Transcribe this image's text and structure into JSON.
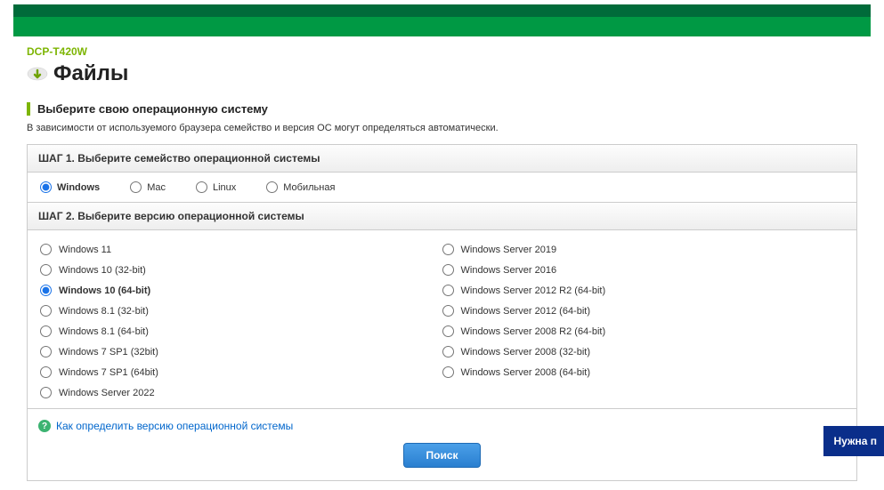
{
  "product_model": "DCP-T420W",
  "page_title": "Файлы",
  "section_heading": "Выберите свою операционную систему",
  "auto_detect_hint": "В зависимости от используемого браузера семейство и версия ОС могут определяться автоматически.",
  "step1_label": "ШАГ 1. Выберите семейство операционной системы",
  "step2_label": "ШАГ 2. Выберите версию операционной системы",
  "os_families": [
    {
      "label": "Windows",
      "selected": true
    },
    {
      "label": "Mac",
      "selected": false
    },
    {
      "label": "Linux",
      "selected": false
    },
    {
      "label": "Мобильная",
      "selected": false
    }
  ],
  "os_versions_col1": [
    {
      "label": "Windows 11",
      "selected": false
    },
    {
      "label": "Windows 10 (32-bit)",
      "selected": false
    },
    {
      "label": "Windows 10 (64-bit)",
      "selected": true
    },
    {
      "label": "Windows 8.1 (32-bit)",
      "selected": false
    },
    {
      "label": "Windows 8.1 (64-bit)",
      "selected": false
    },
    {
      "label": "Windows 7 SP1 (32bit)",
      "selected": false
    },
    {
      "label": "Windows 7 SP1 (64bit)",
      "selected": false
    },
    {
      "label": "Windows Server 2022",
      "selected": false
    }
  ],
  "os_versions_col2": [
    {
      "label": "Windows Server 2019",
      "selected": false
    },
    {
      "label": "Windows Server 2016",
      "selected": false
    },
    {
      "label": "Windows Server 2012 R2 (64-bit)",
      "selected": false
    },
    {
      "label": "Windows Server 2012 (64-bit)",
      "selected": false
    },
    {
      "label": "Windows Server 2008 R2 (64-bit)",
      "selected": false
    },
    {
      "label": "Windows Server 2008 (32-bit)",
      "selected": false
    },
    {
      "label": "Windows Server 2008 (64-bit)",
      "selected": false
    }
  ],
  "help_link_text": "Как определить версию операционной системы",
  "search_button_label": "Поиск",
  "floater_label": "Нужна п"
}
